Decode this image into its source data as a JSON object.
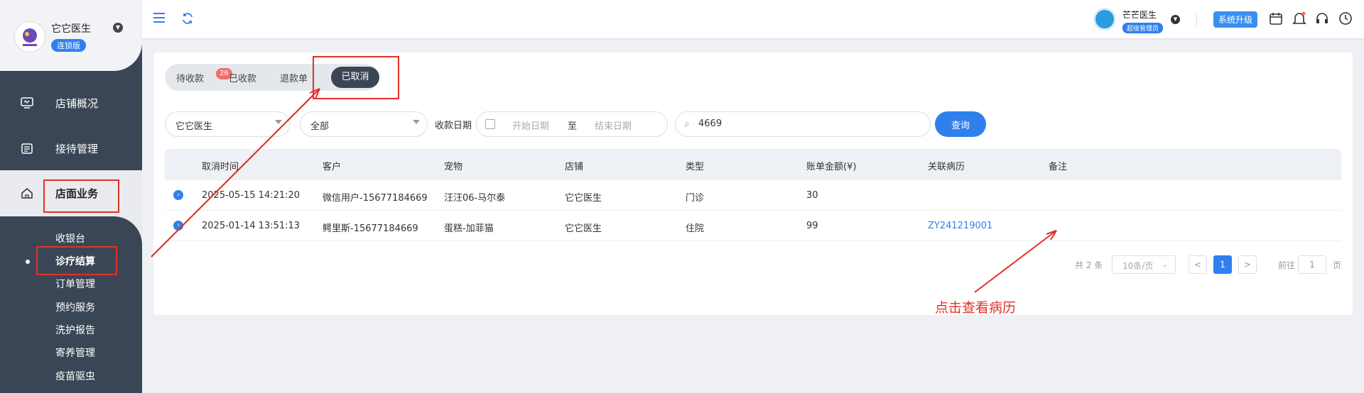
{
  "sidebar": {
    "store_name": "它它医生",
    "edition_badge": "连锁版",
    "nav": [
      {
        "label": "店铺概况",
        "icon": "monitor-icon"
      },
      {
        "label": "接待管理",
        "icon": "reception-icon"
      },
      {
        "label": "店面业务",
        "icon": "home-icon"
      }
    ],
    "sub_items": [
      "收银台",
      "诊疗结算",
      "订单管理",
      "预约服务",
      "洗护报告",
      "寄养管理",
      "疫苗驱虫"
    ],
    "active_sub": "诊疗结算"
  },
  "topbar": {
    "user_name": "芒芒医生",
    "user_role": "超级管理员",
    "upgrade_label": "系统升级",
    "icons": [
      "calendar-icon",
      "bell-icon",
      "headset-icon",
      "clock-icon"
    ]
  },
  "tabs": {
    "items": [
      "待收款",
      "已收款",
      "退款单",
      "已取消"
    ],
    "pending_count": "26",
    "active": "已取消"
  },
  "filters": {
    "store": "它它医生",
    "type": "全部",
    "date_label": "收款日期",
    "date_start_placeholder": "开始日期",
    "date_to": "至",
    "date_end_placeholder": "结束日期",
    "search_value": "4669",
    "query_button": "查询"
  },
  "table": {
    "columns": [
      "取消时间",
      "客户",
      "宠物",
      "店铺",
      "类型",
      "账单金额(¥)",
      "关联病历",
      "备注"
    ],
    "rows": [
      {
        "time": "2025-05-15 14:21:20",
        "customer": "微信用户-15677184669",
        "pet": "汪汪06-马尔泰",
        "store": "它它医生",
        "type": "门诊",
        "amount": "30",
        "record": "",
        "note": ""
      },
      {
        "time": "2025-01-14 13:51:13",
        "customer": "鳄里斯-15677184669",
        "pet": "蛋糕-加菲猫",
        "store": "它它医生",
        "type": "住院",
        "amount": "99",
        "record": "ZY241219001",
        "note": ""
      }
    ]
  },
  "pagination": {
    "total": "共 2 条",
    "page_size": "10条/页",
    "prev": "<",
    "current": "1",
    "next": ">",
    "goto_label": "前往",
    "goto_value": "1",
    "page_unit": "页"
  },
  "annotation": {
    "text": "点击查看病历",
    "color": "#e0312a"
  }
}
